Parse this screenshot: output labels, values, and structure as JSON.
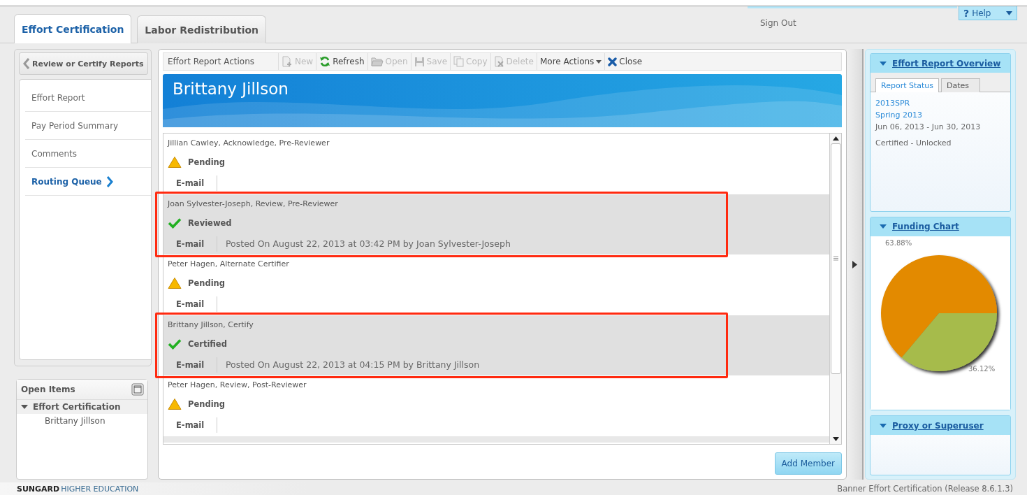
{
  "header": {
    "tabs": [
      {
        "label": "Effort Certification",
        "selected": true
      },
      {
        "label": "Labor Redistribution",
        "selected": false
      }
    ],
    "help_icon": "?",
    "help": "Help",
    "sign_out": "Sign Out"
  },
  "sidebar": {
    "back_button": "Review or Certify Reports",
    "items": [
      {
        "label": "Effort Report",
        "selected": false
      },
      {
        "label": "Pay Period Summary",
        "selected": false
      },
      {
        "label": "Comments",
        "selected": false
      },
      {
        "label": "Routing Queue",
        "selected": true
      }
    ]
  },
  "open_items": {
    "title": "Open Items",
    "group": "Effort Certification",
    "expanded": true,
    "items": [
      "Brittany Jillson"
    ]
  },
  "toolbar": {
    "title": "Effort Report Actions",
    "actions": [
      {
        "label": "New",
        "kind": "new",
        "disabled": true
      },
      {
        "label": "Refresh",
        "kind": "refresh",
        "disabled": false
      },
      {
        "label": "Open",
        "kind": "open",
        "disabled": true
      },
      {
        "label": "Save",
        "kind": "save",
        "disabled": true
      },
      {
        "label": "Copy",
        "kind": "copy",
        "disabled": true
      },
      {
        "label": "Delete",
        "kind": "delete",
        "disabled": true
      },
      {
        "label": "More Actions",
        "kind": "menu",
        "disabled": false
      },
      {
        "label": "Close",
        "kind": "close",
        "disabled": false
      }
    ]
  },
  "banner": {
    "title": "Brittany Jillson"
  },
  "routing_queue": [
    {
      "member": "Jillian Cawley, Acknowledge, Pre-Reviewer",
      "status": "Pending",
      "kind": "pending",
      "contact": "E-mail",
      "shaded": false,
      "highlighted": false
    },
    {
      "member": "Joan Sylvester-Joseph, Review, Pre-Reviewer",
      "status": "Reviewed",
      "kind": "done",
      "contact": "E-mail",
      "posted": "Posted On August 22, 2013 at 03:42 PM by Joan Sylvester-Joseph",
      "shaded": true,
      "highlighted": true
    },
    {
      "member": "Peter Hagen, Alternate Certifier",
      "status": "Pending",
      "kind": "pending",
      "contact": "E-mail",
      "shaded": false,
      "highlighted": false
    },
    {
      "member": "Brittany Jillson, Certify",
      "status": "Certified",
      "kind": "done",
      "contact": "E-mail",
      "posted": "Posted On August 22, 2013 at 04:15 PM by Brittany Jillson",
      "shaded": true,
      "highlighted": true
    },
    {
      "member": "Peter Hagen, Review, Post-Reviewer",
      "status": "Pending",
      "kind": "pending",
      "contact": "E-mail",
      "shaded": false,
      "highlighted": false
    }
  ],
  "add_member": "Add Member",
  "overview": {
    "title": "Effort Report Overview",
    "tabs": [
      {
        "label": "Report Status",
        "selected": true
      },
      {
        "label": "Dates",
        "selected": false
      }
    ],
    "links": [
      "2013SPR",
      "Spring 2013"
    ],
    "date_range": "Jun 06, 2013 - Jun 30, 2013",
    "status": "Certified - Unlocked"
  },
  "funding": {
    "title": "Funding Chart",
    "chart_data": {
      "type": "pie",
      "series": [
        {
          "values": [
            63.88,
            36.12
          ]
        }
      ],
      "colors": [
        "#e38a00",
        "#a6bb4c"
      ],
      "value_labels": [
        "63.88%",
        "36.12%"
      ]
    }
  },
  "proxy": {
    "title": "Proxy or Superuser"
  },
  "footer": {
    "logo_main": "SUNGARD",
    "logo_sub": "HIGHER EDUCATION",
    "release": "Banner Effort Certification (Release 8.6.1.3)"
  }
}
